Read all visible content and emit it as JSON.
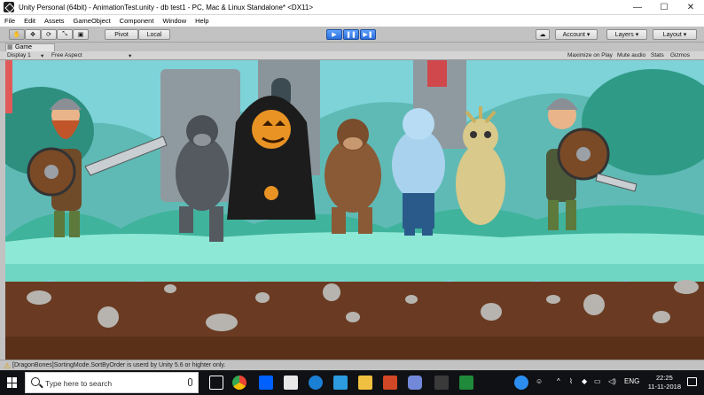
{
  "window": {
    "title": "Unity Personal (64bit) - AnimationTest.unity - db test1 - PC, Mac & Linux Standalone* <DX11>",
    "minimize": "—",
    "maximize": "☐",
    "close": "✕"
  },
  "menu": [
    "File",
    "Edit",
    "Assets",
    "GameObject",
    "Component",
    "Window",
    "Help"
  ],
  "toolbar": {
    "tools": [
      "hand-tool-icon",
      "move-tool-icon",
      "rotate-tool-icon",
      "scale-tool-icon",
      "rect-tool-icon"
    ],
    "pivot": "Pivot",
    "local": "Local",
    "play": "▶",
    "pause": "❚❚",
    "step": "▶❚",
    "account": "Account",
    "layers": "Layers",
    "layout": "Layout"
  },
  "game_panel": {
    "tab": "Game",
    "display": "Display 1",
    "aspect": "Free Aspect",
    "maximize_on_play": "Maximize on Play",
    "mute_audio": "Mute audio",
    "stats": "Stats",
    "gizmos": "Gizmos"
  },
  "console": {
    "message": "[DragonBones]SortingMode.SortByOrder is userd by Unity 5.6 or highter only."
  },
  "taskbar": {
    "search_placeholder": "Type here to search",
    "language": "ENG",
    "time": "22:25",
    "date": "11-11-2018"
  },
  "colors": {
    "sky": "#7dd3d8",
    "ground": "#6a3b22",
    "grass": "#7fe0cc",
    "unity_blue": "#2b6fdb"
  }
}
